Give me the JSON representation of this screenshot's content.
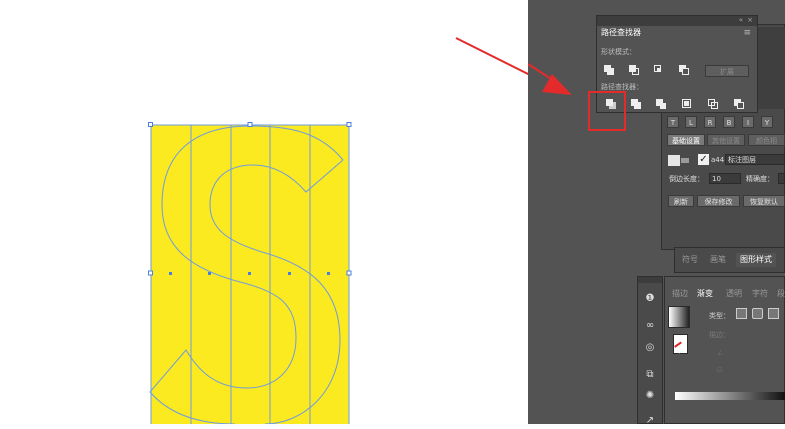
{
  "colors": {
    "artboard_fill": "#fbea1f",
    "path_stroke": "#6f9be0",
    "selection": "#4a7fdc",
    "annotation": "#e32b2b",
    "panel_bg": "#535353"
  },
  "pathfinder": {
    "title": "路径查找器",
    "shape_modes_label": "形状模式：",
    "expand_label": "扩展",
    "pathfinders_label": "路径查找器："
  },
  "plugin": {
    "row_buttons": [
      "T",
      "L",
      "R",
      "B",
      "I",
      "Y"
    ],
    "tabs": [
      "基础设置",
      "其他设置",
      "颜色相"
    ],
    "layer_value": "a44",
    "layer_label": "标注图层",
    "side_length_label": "倒边长度：",
    "side_length_value": "10",
    "precision_label": "精确度：",
    "refresh_label": "刷新",
    "save_label": "保存修改",
    "restore_label": "恢复默认"
  },
  "styles_panel": {
    "tabs": [
      "符号",
      "画笔",
      "图形样式"
    ]
  },
  "gradient_panel": {
    "tabs": [
      "描边",
      "渐变",
      "透明",
      "字符",
      "段"
    ],
    "type_label": "类型：",
    "stroke_label": "描边："
  },
  "toolbar_icons": [
    "info-icon",
    "links-icon",
    "appearance-icon",
    "transform-icon",
    "color-guide-icon",
    "export-icon"
  ]
}
